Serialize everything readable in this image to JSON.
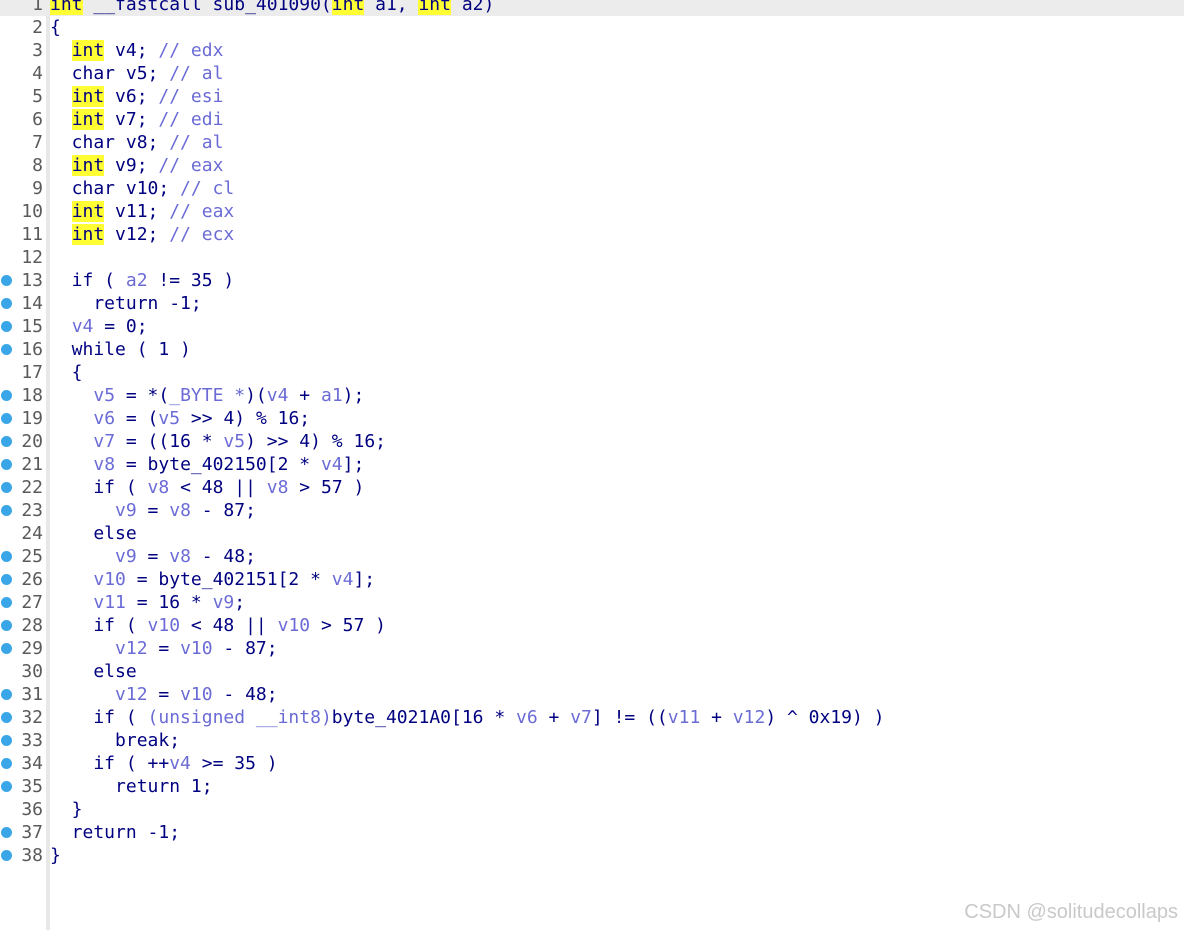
{
  "editor": {
    "accent_color": "#ffff33",
    "breakpoint_color": "#3aa6e8",
    "lines": [
      {
        "num": "1",
        "bp": false,
        "current": true,
        "tokens": [
          {
            "t": "int",
            "k": "type-hl"
          },
          {
            "t": " __fastcall sub_401090(",
            "k": "plain"
          },
          {
            "t": "int",
            "k": "type-hl"
          },
          {
            "t": " a1, ",
            "k": "plain"
          },
          {
            "t": "int",
            "k": "type-hl"
          },
          {
            "t": " a2)",
            "k": "plain"
          }
        ]
      },
      {
        "num": "2",
        "bp": false,
        "current": false,
        "tokens": [
          {
            "t": "{",
            "k": "plain"
          }
        ]
      },
      {
        "num": "3",
        "bp": false,
        "current": false,
        "tokens": [
          {
            "t": "  ",
            "k": "plain"
          },
          {
            "t": "int",
            "k": "type-hl"
          },
          {
            "t": " v4; ",
            "k": "plain"
          },
          {
            "t": "// edx",
            "k": "cmt"
          }
        ]
      },
      {
        "num": "4",
        "bp": false,
        "current": false,
        "tokens": [
          {
            "t": "  char v5; ",
            "k": "plain"
          },
          {
            "t": "// al",
            "k": "cmt"
          }
        ]
      },
      {
        "num": "5",
        "bp": false,
        "current": false,
        "tokens": [
          {
            "t": "  ",
            "k": "plain"
          },
          {
            "t": "int",
            "k": "type-hl"
          },
          {
            "t": " v6; ",
            "k": "plain"
          },
          {
            "t": "// esi",
            "k": "cmt"
          }
        ]
      },
      {
        "num": "6",
        "bp": false,
        "current": false,
        "tokens": [
          {
            "t": "  ",
            "k": "plain"
          },
          {
            "t": "int",
            "k": "type-hl"
          },
          {
            "t": " v7; ",
            "k": "plain"
          },
          {
            "t": "// edi",
            "k": "cmt"
          }
        ]
      },
      {
        "num": "7",
        "bp": false,
        "current": false,
        "tokens": [
          {
            "t": "  char v8; ",
            "k": "plain"
          },
          {
            "t": "// al",
            "k": "cmt"
          }
        ]
      },
      {
        "num": "8",
        "bp": false,
        "current": false,
        "tokens": [
          {
            "t": "  ",
            "k": "plain"
          },
          {
            "t": "int",
            "k": "type-hl"
          },
          {
            "t": " v9; ",
            "k": "plain"
          },
          {
            "t": "// eax",
            "k": "cmt"
          }
        ]
      },
      {
        "num": "9",
        "bp": false,
        "current": false,
        "tokens": [
          {
            "t": "  char v10; ",
            "k": "plain"
          },
          {
            "t": "// cl",
            "k": "cmt"
          }
        ]
      },
      {
        "num": "10",
        "bp": false,
        "current": false,
        "tokens": [
          {
            "t": "  ",
            "k": "plain"
          },
          {
            "t": "int",
            "k": "type-hl"
          },
          {
            "t": " v11; ",
            "k": "plain"
          },
          {
            "t": "// eax",
            "k": "cmt"
          }
        ]
      },
      {
        "num": "11",
        "bp": false,
        "current": false,
        "tokens": [
          {
            "t": "  ",
            "k": "plain"
          },
          {
            "t": "int",
            "k": "type-hl"
          },
          {
            "t": " v12; ",
            "k": "plain"
          },
          {
            "t": "// ecx",
            "k": "cmt"
          }
        ]
      },
      {
        "num": "12",
        "bp": false,
        "current": false,
        "tokens": []
      },
      {
        "num": "13",
        "bp": true,
        "current": false,
        "tokens": [
          {
            "t": "  if ( ",
            "k": "plain"
          },
          {
            "t": "a2",
            "k": "var"
          },
          {
            "t": " != 35 )",
            "k": "plain"
          }
        ]
      },
      {
        "num": "14",
        "bp": true,
        "current": false,
        "tokens": [
          {
            "t": "    return -1;",
            "k": "plain"
          }
        ]
      },
      {
        "num": "15",
        "bp": true,
        "current": false,
        "tokens": [
          {
            "t": "  ",
            "k": "plain"
          },
          {
            "t": "v4",
            "k": "var"
          },
          {
            "t": " = 0;",
            "k": "plain"
          }
        ]
      },
      {
        "num": "16",
        "bp": true,
        "current": false,
        "tokens": [
          {
            "t": "  while ( 1 )",
            "k": "plain"
          }
        ]
      },
      {
        "num": "17",
        "bp": false,
        "current": false,
        "tokens": [
          {
            "t": "  {",
            "k": "plain"
          }
        ]
      },
      {
        "num": "18",
        "bp": true,
        "current": false,
        "tokens": [
          {
            "t": "    ",
            "k": "plain"
          },
          {
            "t": "v5",
            "k": "var"
          },
          {
            "t": " = *(",
            "k": "plain"
          },
          {
            "t": "_BYTE *",
            "k": "var"
          },
          {
            "t": ")(",
            "k": "plain"
          },
          {
            "t": "v4",
            "k": "var"
          },
          {
            "t": " + ",
            "k": "plain"
          },
          {
            "t": "a1",
            "k": "var"
          },
          {
            "t": ");",
            "k": "plain"
          }
        ]
      },
      {
        "num": "19",
        "bp": true,
        "current": false,
        "tokens": [
          {
            "t": "    ",
            "k": "plain"
          },
          {
            "t": "v6",
            "k": "var"
          },
          {
            "t": " = (",
            "k": "plain"
          },
          {
            "t": "v5",
            "k": "var"
          },
          {
            "t": " >> 4) % 16;",
            "k": "plain"
          }
        ]
      },
      {
        "num": "20",
        "bp": true,
        "current": false,
        "tokens": [
          {
            "t": "    ",
            "k": "plain"
          },
          {
            "t": "v7",
            "k": "var"
          },
          {
            "t": " = ((16 * ",
            "k": "plain"
          },
          {
            "t": "v5",
            "k": "var"
          },
          {
            "t": ") >> 4) % 16;",
            "k": "plain"
          }
        ]
      },
      {
        "num": "21",
        "bp": true,
        "current": false,
        "tokens": [
          {
            "t": "    ",
            "k": "plain"
          },
          {
            "t": "v8",
            "k": "var"
          },
          {
            "t": " = byte_402150[2 * ",
            "k": "plain"
          },
          {
            "t": "v4",
            "k": "var"
          },
          {
            "t": "];",
            "k": "plain"
          }
        ]
      },
      {
        "num": "22",
        "bp": true,
        "current": false,
        "tokens": [
          {
            "t": "    if ( ",
            "k": "plain"
          },
          {
            "t": "v8",
            "k": "var"
          },
          {
            "t": " < 48 || ",
            "k": "plain"
          },
          {
            "t": "v8",
            "k": "var"
          },
          {
            "t": " > 57 )",
            "k": "plain"
          }
        ]
      },
      {
        "num": "23",
        "bp": true,
        "current": false,
        "tokens": [
          {
            "t": "      ",
            "k": "plain"
          },
          {
            "t": "v9",
            "k": "var"
          },
          {
            "t": " = ",
            "k": "plain"
          },
          {
            "t": "v8",
            "k": "var"
          },
          {
            "t": " - 87;",
            "k": "plain"
          }
        ]
      },
      {
        "num": "24",
        "bp": false,
        "current": false,
        "tokens": [
          {
            "t": "    else",
            "k": "plain"
          }
        ]
      },
      {
        "num": "25",
        "bp": true,
        "current": false,
        "tokens": [
          {
            "t": "      ",
            "k": "plain"
          },
          {
            "t": "v9",
            "k": "var"
          },
          {
            "t": " = ",
            "k": "plain"
          },
          {
            "t": "v8",
            "k": "var"
          },
          {
            "t": " - 48;",
            "k": "plain"
          }
        ]
      },
      {
        "num": "26",
        "bp": true,
        "current": false,
        "tokens": [
          {
            "t": "    ",
            "k": "plain"
          },
          {
            "t": "v10",
            "k": "var"
          },
          {
            "t": " = byte_402151[2 * ",
            "k": "plain"
          },
          {
            "t": "v4",
            "k": "var"
          },
          {
            "t": "];",
            "k": "plain"
          }
        ]
      },
      {
        "num": "27",
        "bp": true,
        "current": false,
        "tokens": [
          {
            "t": "    ",
            "k": "plain"
          },
          {
            "t": "v11",
            "k": "var"
          },
          {
            "t": " = 16 * ",
            "k": "plain"
          },
          {
            "t": "v9",
            "k": "var"
          },
          {
            "t": ";",
            "k": "plain"
          }
        ]
      },
      {
        "num": "28",
        "bp": true,
        "current": false,
        "tokens": [
          {
            "t": "    if ( ",
            "k": "plain"
          },
          {
            "t": "v10",
            "k": "var"
          },
          {
            "t": " < 48 || ",
            "k": "plain"
          },
          {
            "t": "v10",
            "k": "var"
          },
          {
            "t": " > 57 )",
            "k": "plain"
          }
        ]
      },
      {
        "num": "29",
        "bp": true,
        "current": false,
        "tokens": [
          {
            "t": "      ",
            "k": "plain"
          },
          {
            "t": "v12",
            "k": "var"
          },
          {
            "t": " = ",
            "k": "plain"
          },
          {
            "t": "v10",
            "k": "var"
          },
          {
            "t": " - 87;",
            "k": "plain"
          }
        ]
      },
      {
        "num": "30",
        "bp": false,
        "current": false,
        "tokens": [
          {
            "t": "    else",
            "k": "plain"
          }
        ]
      },
      {
        "num": "31",
        "bp": true,
        "current": false,
        "tokens": [
          {
            "t": "      ",
            "k": "plain"
          },
          {
            "t": "v12",
            "k": "var"
          },
          {
            "t": " = ",
            "k": "plain"
          },
          {
            "t": "v10",
            "k": "var"
          },
          {
            "t": " - 48;",
            "k": "plain"
          }
        ]
      },
      {
        "num": "32",
        "bp": true,
        "current": false,
        "tokens": [
          {
            "t": "    if ( ",
            "k": "plain"
          },
          {
            "t": "(unsigned __int8)",
            "k": "var"
          },
          {
            "t": "byte_4021A0[16 * ",
            "k": "plain"
          },
          {
            "t": "v6",
            "k": "var"
          },
          {
            "t": " + ",
            "k": "plain"
          },
          {
            "t": "v7",
            "k": "var"
          },
          {
            "t": "] != ((",
            "k": "plain"
          },
          {
            "t": "v11",
            "k": "var"
          },
          {
            "t": " + ",
            "k": "plain"
          },
          {
            "t": "v12",
            "k": "var"
          },
          {
            "t": ") ^ 0x19) )",
            "k": "plain"
          }
        ]
      },
      {
        "num": "33",
        "bp": true,
        "current": false,
        "tokens": [
          {
            "t": "      break;",
            "k": "plain"
          }
        ]
      },
      {
        "num": "34",
        "bp": true,
        "current": false,
        "tokens": [
          {
            "t": "    if ( ++",
            "k": "plain"
          },
          {
            "t": "v4",
            "k": "var"
          },
          {
            "t": " >= 35 )",
            "k": "plain"
          }
        ]
      },
      {
        "num": "35",
        "bp": true,
        "current": false,
        "tokens": [
          {
            "t": "      return 1;",
            "k": "plain"
          }
        ]
      },
      {
        "num": "36",
        "bp": false,
        "current": false,
        "tokens": [
          {
            "t": "  }",
            "k": "plain"
          }
        ]
      },
      {
        "num": "37",
        "bp": true,
        "current": false,
        "tokens": [
          {
            "t": "  return -1;",
            "k": "plain"
          }
        ]
      },
      {
        "num": "38",
        "bp": true,
        "current": false,
        "tokens": [
          {
            "t": "}",
            "k": "plain"
          }
        ]
      }
    ]
  },
  "watermark": {
    "text": "CSDN @solitudecollaps"
  }
}
